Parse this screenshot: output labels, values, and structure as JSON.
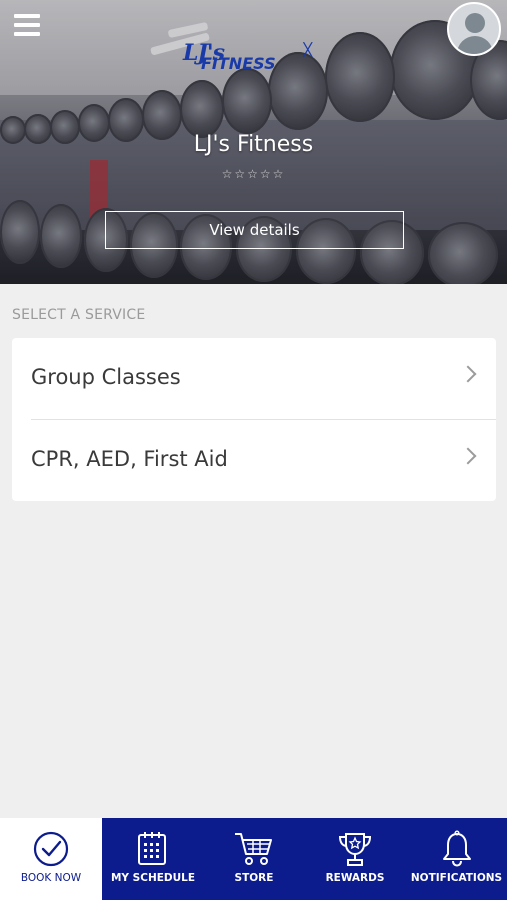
{
  "hero": {
    "gym_name": "LJ's Fitness",
    "logo_text_top": "LJ's",
    "logo_text_bottom": "FITNESS",
    "rating_stars": "☆☆☆☆☆",
    "view_details_label": "View details"
  },
  "services": {
    "section_label": "SELECT A SERVICE",
    "items": [
      {
        "label": "Group Classes"
      },
      {
        "label": "CPR, AED, First Aid"
      }
    ]
  },
  "bottom_nav": {
    "items": [
      {
        "label": "BOOK NOW",
        "icon": "check-circle-icon",
        "active": true
      },
      {
        "label": "MY SCHEDULE",
        "icon": "calendar-icon",
        "active": false
      },
      {
        "label": "STORE",
        "icon": "cart-icon",
        "active": false
      },
      {
        "label": "REWARDS",
        "icon": "trophy-icon",
        "active": false
      },
      {
        "label": "NOTIFICATIONS",
        "icon": "bell-icon",
        "active": false
      }
    ]
  },
  "colors": {
    "nav_background": "#0c1c8c",
    "card_background": "#ffffff",
    "page_background": "#efefef"
  }
}
